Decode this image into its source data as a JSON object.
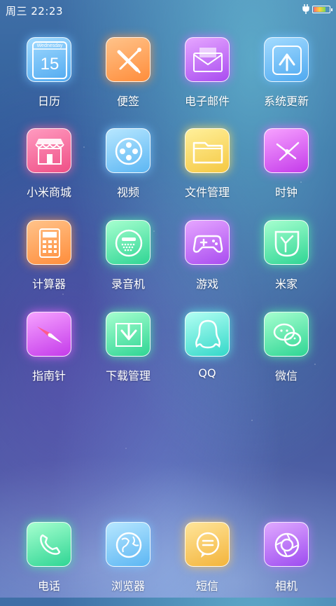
{
  "status_bar": {
    "day_time": "周三  22:23",
    "icons": [
      "charging-icon",
      "battery-icon"
    ]
  },
  "apps": [
    {
      "label": "日历",
      "icon": "calendar-icon",
      "color": "#59aef2",
      "calendar": {
        "weekday": "Wednesday",
        "date": "15"
      }
    },
    {
      "label": "便签",
      "icon": "notes-icon",
      "color": "#ff8d3b"
    },
    {
      "label": "电子邮件",
      "icon": "email-icon",
      "color": "#a94cf0"
    },
    {
      "label": "系统更新",
      "icon": "update-icon",
      "color": "#4fa9f0"
    },
    {
      "label": "小米商城",
      "icon": "store-icon",
      "color": "#ef4f86"
    },
    {
      "label": "视频",
      "icon": "video-icon",
      "color": "#4fa9f0"
    },
    {
      "label": "文件管理",
      "icon": "folder-icon",
      "color": "#f5c842"
    },
    {
      "label": "时钟",
      "icon": "clock-icon",
      "color": "#c43bea"
    },
    {
      "label": "计算器",
      "icon": "calculator-icon",
      "color": "#ff8d3b"
    },
    {
      "label": "录音机",
      "icon": "recorder-icon",
      "color": "#2fd594"
    },
    {
      "label": "游戏",
      "icon": "gamepad-icon",
      "color": "#a94cf0"
    },
    {
      "label": "米家",
      "icon": "mihome-icon",
      "color": "#2fd594"
    },
    {
      "label": "指南针",
      "icon": "compass-icon",
      "color": "#c43bea"
    },
    {
      "label": "下载管理",
      "icon": "download-icon",
      "color": "#2fd594"
    },
    {
      "label": "QQ",
      "icon": "qq-icon",
      "color": "#34d8c9"
    },
    {
      "label": "微信",
      "icon": "wechat-icon",
      "color": "#2fd594"
    }
  ],
  "dock": [
    {
      "label": "电话",
      "icon": "phone-icon",
      "color": "#2fd594"
    },
    {
      "label": "浏览器",
      "icon": "browser-icon",
      "color": "#5cb6f3"
    },
    {
      "label": "短信",
      "icon": "sms-icon",
      "color": "#f3b43b"
    },
    {
      "label": "相机",
      "icon": "camera-icon",
      "color": "#9d4cf0"
    }
  ]
}
